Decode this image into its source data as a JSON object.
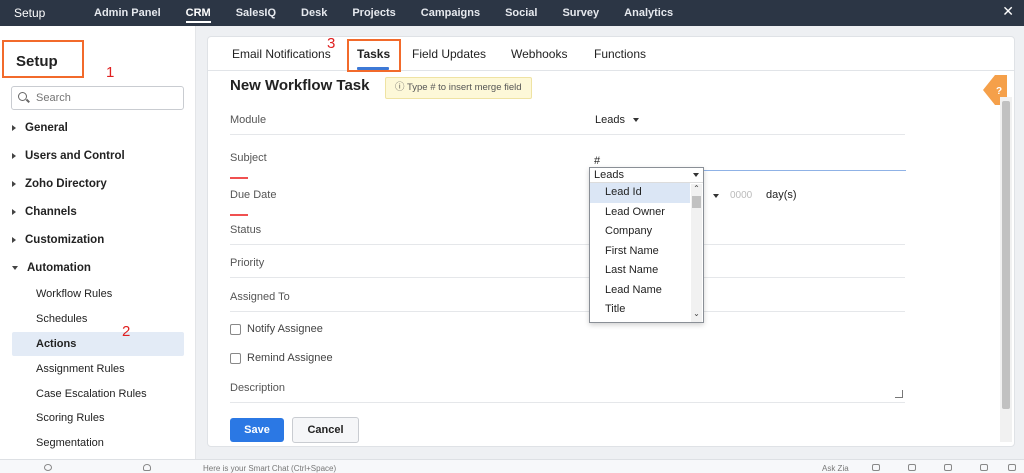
{
  "topbar": {
    "app_title": "Setup",
    "nav": [
      "Admin Panel",
      "CRM",
      "SalesIQ",
      "Desk",
      "Projects",
      "Campaigns",
      "Social",
      "Survey",
      "Analytics"
    ],
    "active": "CRM",
    "close_glyph": "✕"
  },
  "annotations": [
    "1",
    "2",
    "3"
  ],
  "sidebar": {
    "title": "Setup",
    "search_placeholder": "Search",
    "groups": [
      "General",
      "Users and Control",
      "Zoho Directory",
      "Channels",
      "Customization",
      "Automation"
    ],
    "automation_items": [
      "Workflow Rules",
      "Schedules",
      "Actions",
      "Assignment Rules",
      "Case Escalation Rules",
      "Scoring Rules",
      "Segmentation"
    ],
    "active_item": "Actions"
  },
  "tabs": [
    "Email Notifications",
    "Tasks",
    "Field Updates",
    "Webhooks",
    "Functions"
  ],
  "active_tab": "Tasks",
  "form": {
    "title": "New Workflow Task",
    "hint_icon": "ⓘ",
    "hint": "Type # to insert merge field",
    "module_label": "Module",
    "module_value": "Leads",
    "subject_label": "Subject",
    "subject_value": "#",
    "due_date_label": "Due Date",
    "days_placeholder": "0000",
    "days_unit": "day(s)",
    "status_label": "Status",
    "priority_label": "Priority",
    "assigned_to_label": "Assigned To",
    "notify_label": "Notify Assignee",
    "remind_label": "Remind Assignee",
    "description_label": "Description",
    "save_label": "Save",
    "cancel_label": "Cancel",
    "help_glyph": "?"
  },
  "merge_dropdown": {
    "module": "Leads",
    "options": [
      "Lead Id",
      "Lead Owner",
      "Company",
      "First Name",
      "Last Name",
      "Lead Name",
      "Title"
    ],
    "selected": "Lead Id"
  },
  "bottombar": {
    "chat_placeholder": "Here is your Smart Chat (Ctrl+Space)",
    "ask_zia": "Ask Zia"
  },
  "colors": {
    "topbar": "#2c3645",
    "annotation_box": "#f26a2b",
    "annotation_text": "#e02020",
    "primary_button": "#2b78e4",
    "active_tab_underline": "#3d79d6"
  }
}
